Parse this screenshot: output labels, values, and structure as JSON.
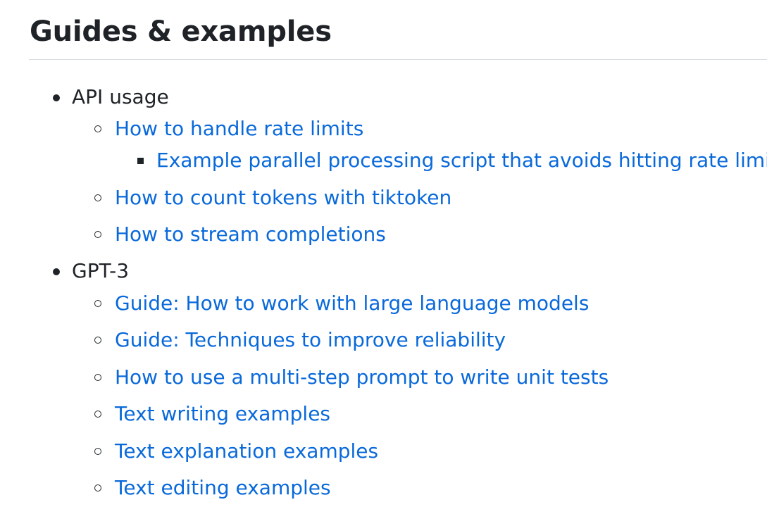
{
  "section": {
    "title": "Guides & examples",
    "groups": [
      {
        "label": "API usage",
        "links": [
          {
            "label": "How to handle rate limits",
            "children": [
              {
                "label": "Example parallel processing script that avoids hitting rate limits"
              }
            ]
          },
          {
            "label": "How to count tokens with tiktoken"
          },
          {
            "label": "How to stream completions"
          }
        ]
      },
      {
        "label": "GPT-3",
        "links": [
          {
            "label": "Guide: How to work with large language models"
          },
          {
            "label": "Guide: Techniques to improve reliability"
          },
          {
            "label": "How to use a multi-step prompt to write unit tests"
          },
          {
            "label": "Text writing examples"
          },
          {
            "label": "Text explanation examples"
          },
          {
            "label": "Text editing examples"
          }
        ]
      }
    ]
  },
  "colors": {
    "text": "#1f2328",
    "link": "#0969da",
    "rule": "#d8dee4"
  }
}
